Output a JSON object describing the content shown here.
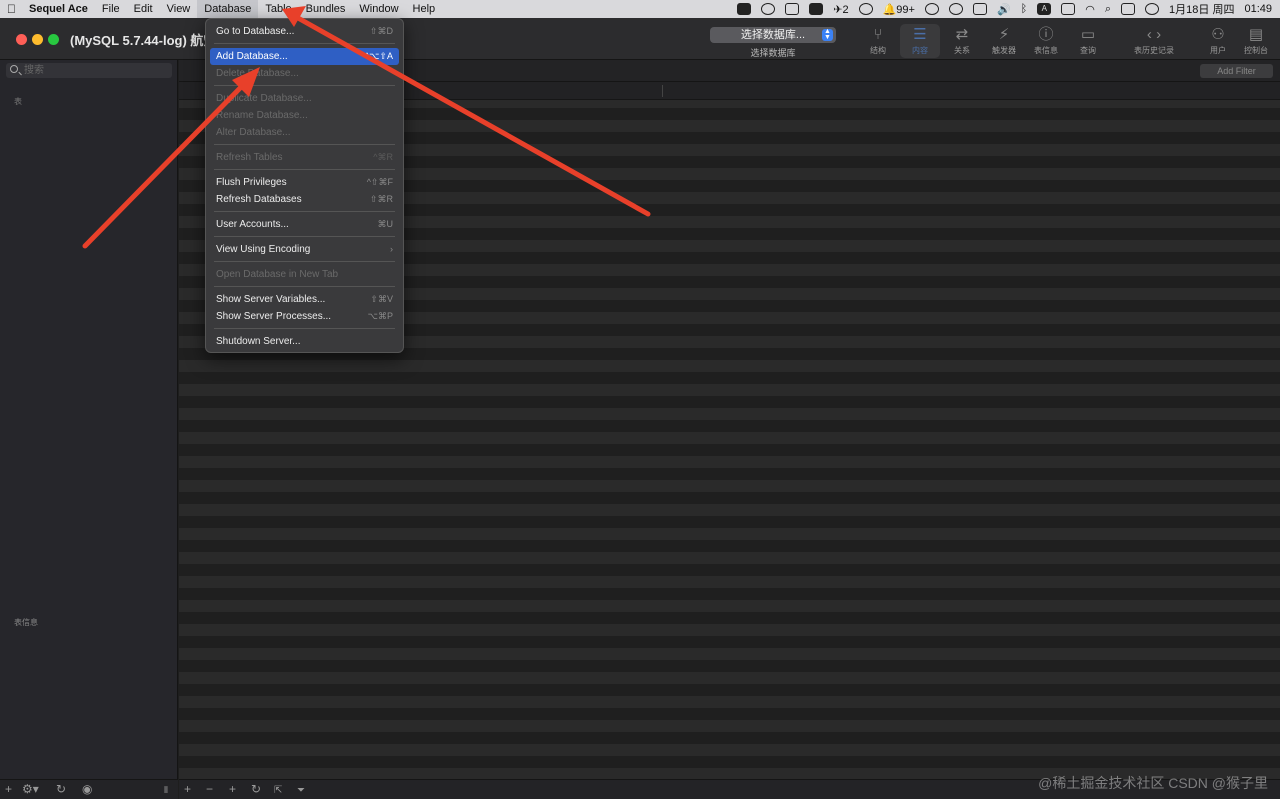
{
  "menubar": {
    "app_name": "Sequel Ace",
    "items": [
      "File",
      "Edit",
      "View",
      "Database",
      "Table",
      "Bundles",
      "Window",
      "Help"
    ],
    "status": {
      "badge_two": "2",
      "badge_99": "99+",
      "input_method": "A",
      "date": "1月18日 周四",
      "time": "01:49"
    }
  },
  "window": {
    "title": "(MySQL 5.7.44-log) 航空"
  },
  "toolbar": {
    "db_select_value": "选择数据库...",
    "db_select_caption": "选择数据库",
    "buttons": [
      {
        "label": "结构",
        "icon": "structure-icon",
        "glyph": "⑂"
      },
      {
        "label": "内容",
        "icon": "content-list-icon",
        "glyph": "☰"
      },
      {
        "label": "关系",
        "icon": "relations-icon",
        "glyph": "⇄"
      },
      {
        "label": "触发器",
        "icon": "triggers-icon",
        "glyph": "⚡"
      },
      {
        "label": "表信息",
        "icon": "info-icon",
        "glyph": "ⓘ"
      },
      {
        "label": "查询",
        "icon": "query-terminal-icon",
        "glyph": "▭"
      }
    ],
    "history_label": "表历史记录",
    "users_label": "用户",
    "console_label": "控制台"
  },
  "sidebar": {
    "search_placeholder": "搜索",
    "tables_label": "表",
    "table_info_label": "表信息"
  },
  "content": {
    "add_filter_label": "Add Filter"
  },
  "database_menu": {
    "items": [
      {
        "label": "Go to Database...",
        "shortcut": "⇧⌘D",
        "enabled": true
      },
      {
        "sep": true
      },
      {
        "label": "Add Database...",
        "shortcut": "^⌥⇧A",
        "enabled": true,
        "highlighted": true
      },
      {
        "label": "Delete Database...",
        "shortcut": "",
        "enabled": false
      },
      {
        "sep": true
      },
      {
        "label": "Duplicate Database...",
        "shortcut": "",
        "enabled": false
      },
      {
        "label": "Rename Database...",
        "shortcut": "",
        "enabled": false
      },
      {
        "label": "Alter Database...",
        "shortcut": "",
        "enabled": false
      },
      {
        "sep": true
      },
      {
        "label": "Refresh Tables",
        "shortcut": "^⌘R",
        "enabled": false
      },
      {
        "sep": true
      },
      {
        "label": "Flush Privileges",
        "shortcut": "^⇧⌘F",
        "enabled": true
      },
      {
        "label": "Refresh Databases",
        "shortcut": "⇧⌘R",
        "enabled": true
      },
      {
        "sep": true
      },
      {
        "label": "User Accounts...",
        "shortcut": "⌘U",
        "enabled": true
      },
      {
        "sep": true
      },
      {
        "label": "View Using Encoding",
        "shortcut": "›",
        "enabled": true
      },
      {
        "sep": true
      },
      {
        "label": "Open Database in New Tab",
        "shortcut": "",
        "enabled": false
      },
      {
        "sep": true
      },
      {
        "label": "Show Server Variables...",
        "shortcut": "⇧⌘V",
        "enabled": true
      },
      {
        "label": "Show Server Processes...",
        "shortcut": "⌥⌘P",
        "enabled": true
      },
      {
        "sep": true
      },
      {
        "label": "Shutdown Server...",
        "shortcut": "",
        "enabled": true
      }
    ]
  },
  "watermark": "@稀土掘金技术社区 CSDN @猴子里",
  "colors": {
    "accent": "#2f5fc4",
    "annotation_arrow": "#e8402a",
    "close": "#ff5f57",
    "minimize": "#febc2e",
    "zoom": "#28c840"
  }
}
